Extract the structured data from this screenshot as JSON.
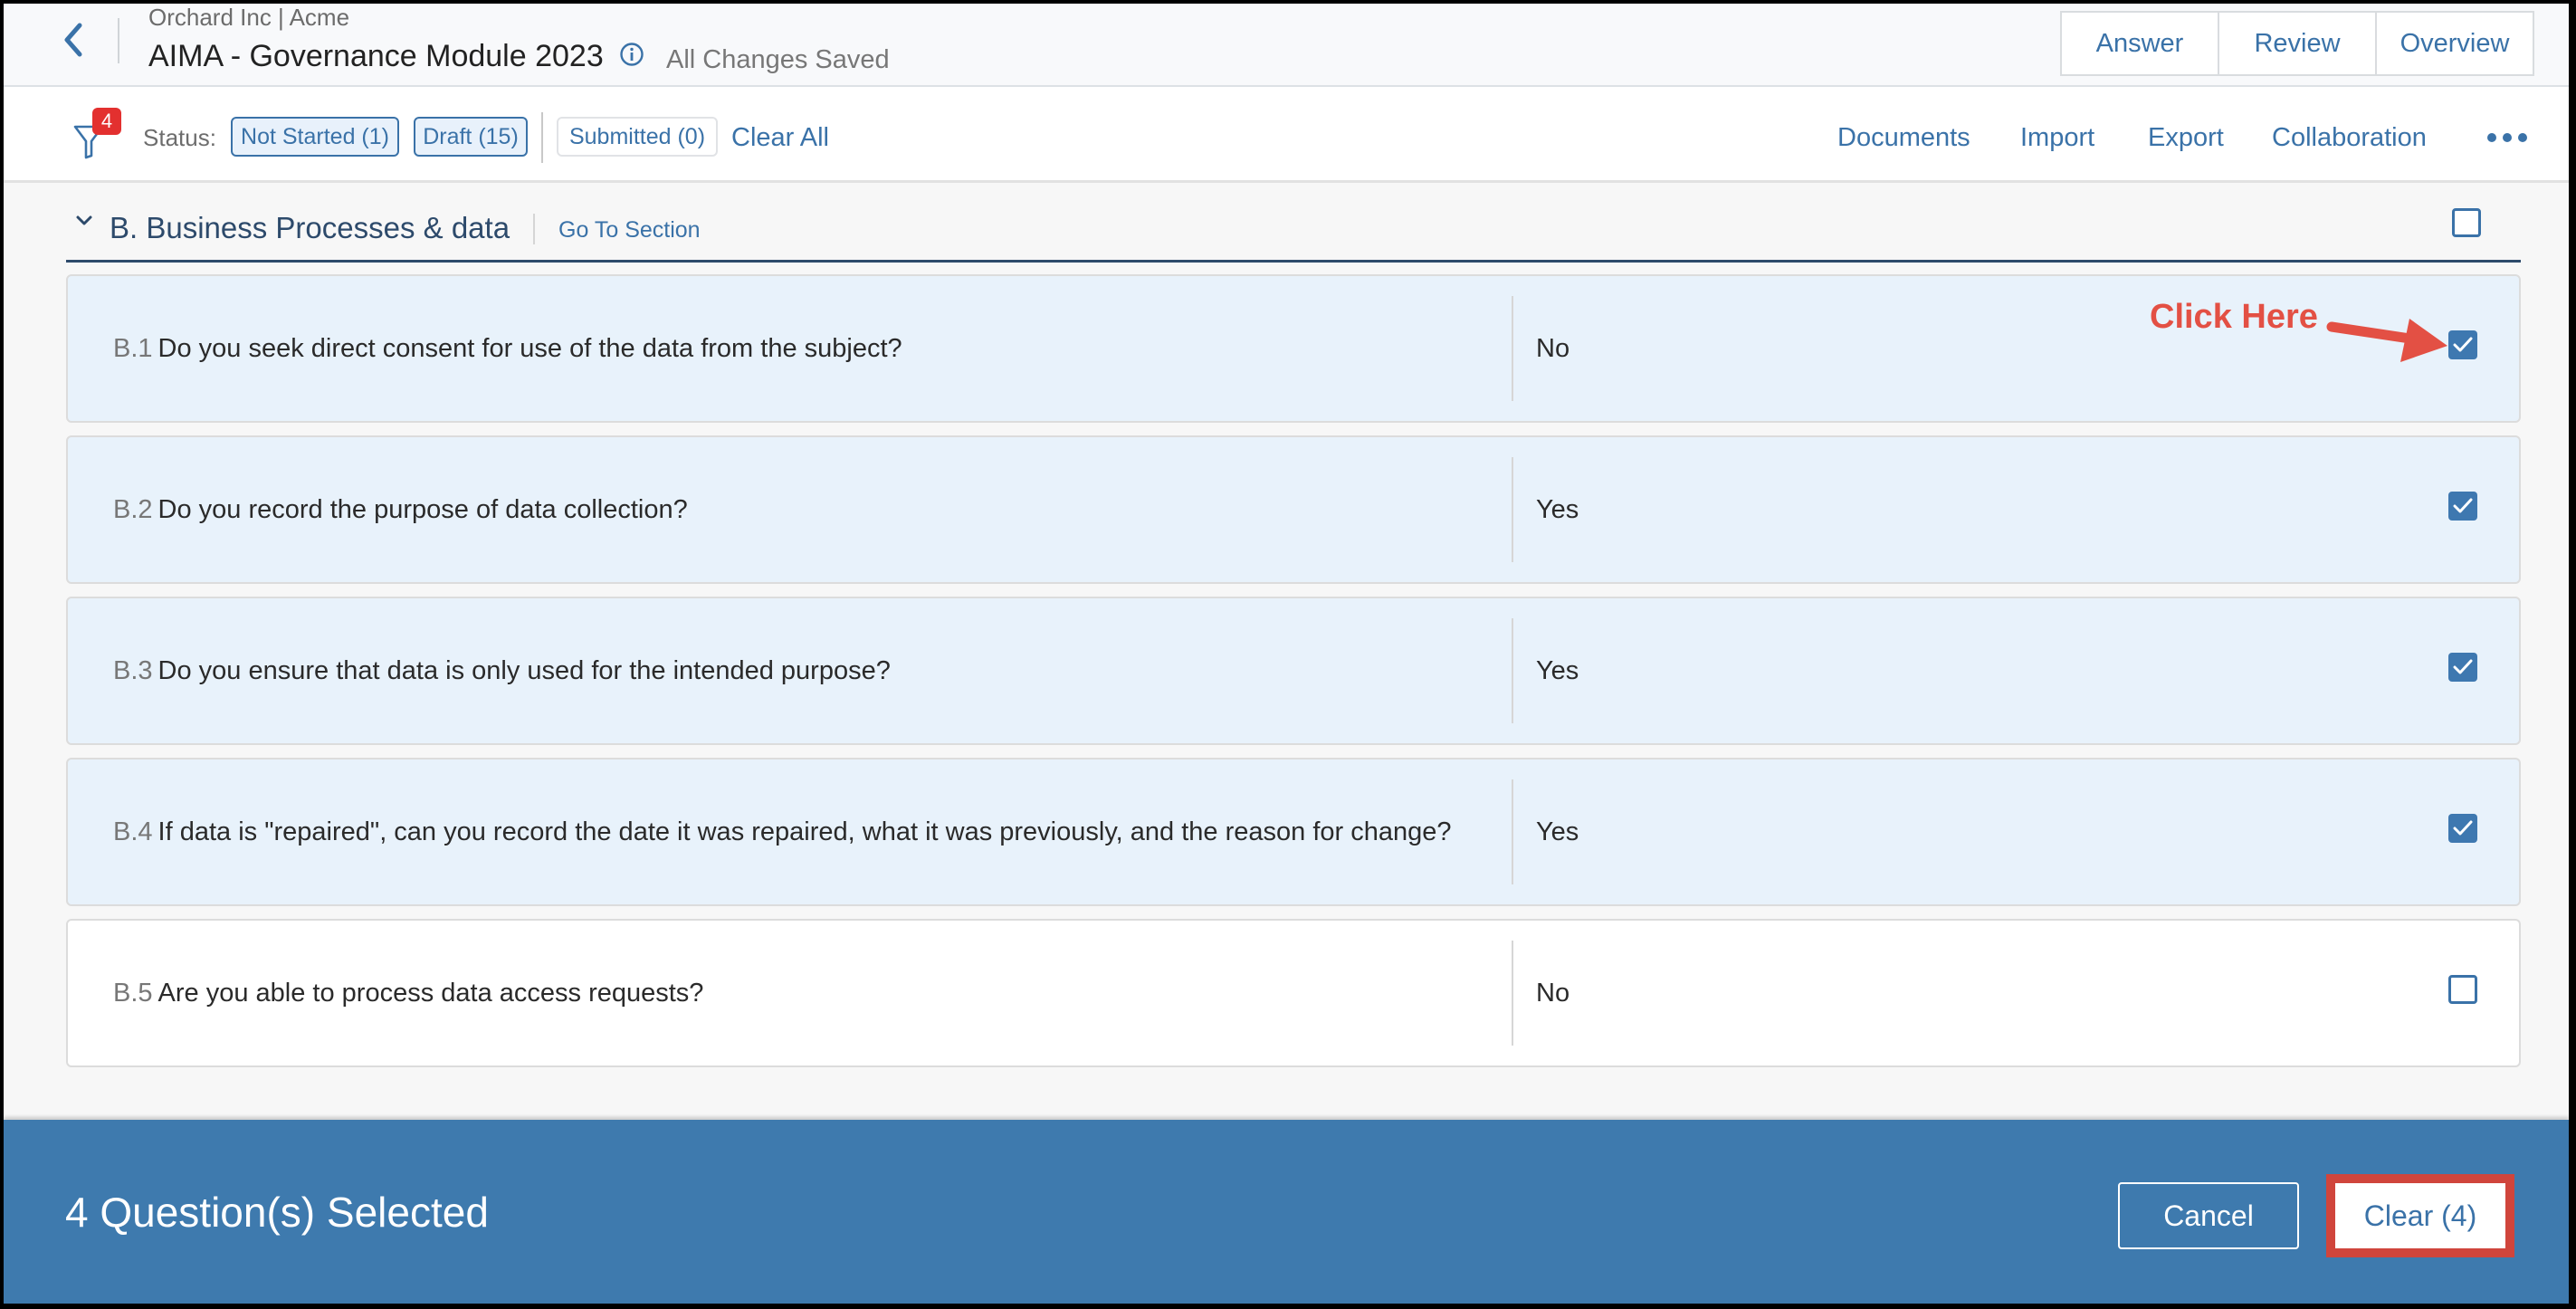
{
  "header": {
    "breadcrumb": "Orchard Inc | Acme",
    "title": "AIMA - Governance Module 2023",
    "save_status": "All Changes Saved",
    "view_tabs": [
      {
        "label": "Answer"
      },
      {
        "label": "Review"
      },
      {
        "label": "Overview"
      }
    ]
  },
  "filter_bar": {
    "filter_badge_count": "4",
    "status_label": "Status:",
    "chips": [
      {
        "label": "Not Started (1)",
        "active": true
      },
      {
        "label": "Draft (15)",
        "active": true
      },
      {
        "label": "Submitted (0)",
        "active": false
      }
    ],
    "clear_all_label": "Clear All",
    "nav_links": [
      {
        "label": "Documents"
      },
      {
        "label": "Import"
      },
      {
        "label": "Export"
      },
      {
        "label": "Collaboration"
      }
    ],
    "more_icon": "ellipsis-icon"
  },
  "section": {
    "title": "B. Business Processes & data",
    "goto_label": "Go To Section",
    "select_all_checked": false
  },
  "questions": [
    {
      "number": "B.1",
      "text": "Do you seek direct consent for use of the data from the subject?",
      "answer": "No",
      "selected": true
    },
    {
      "number": "B.2",
      "text": "Do you record the purpose of data collection?",
      "answer": "Yes",
      "selected": true
    },
    {
      "number": "B.3",
      "text": "Do you ensure that data is only used for the intended purpose?",
      "answer": "Yes",
      "selected": true
    },
    {
      "number": "B.4",
      "text": "If data is \"repaired\", can you record the date it was repaired, what it was previously, and the reason for change?",
      "answer": "Yes",
      "selected": true
    },
    {
      "number": "B.5",
      "text": "Are you able to process data access requests?",
      "answer": "No",
      "selected": false
    }
  ],
  "annotation": {
    "text": "Click Here",
    "color": "#e35044"
  },
  "footer": {
    "selected_count_text": "4 Question(s) Selected",
    "cancel_label": "Cancel",
    "clear_label": "Clear (4)"
  },
  "colors": {
    "accent": "#3a72a8",
    "footer_bg": "#3e7aae",
    "selected_row_bg": "#e8f2fb",
    "badge": "#e3302f",
    "highlight_outline": "#d0453c"
  }
}
